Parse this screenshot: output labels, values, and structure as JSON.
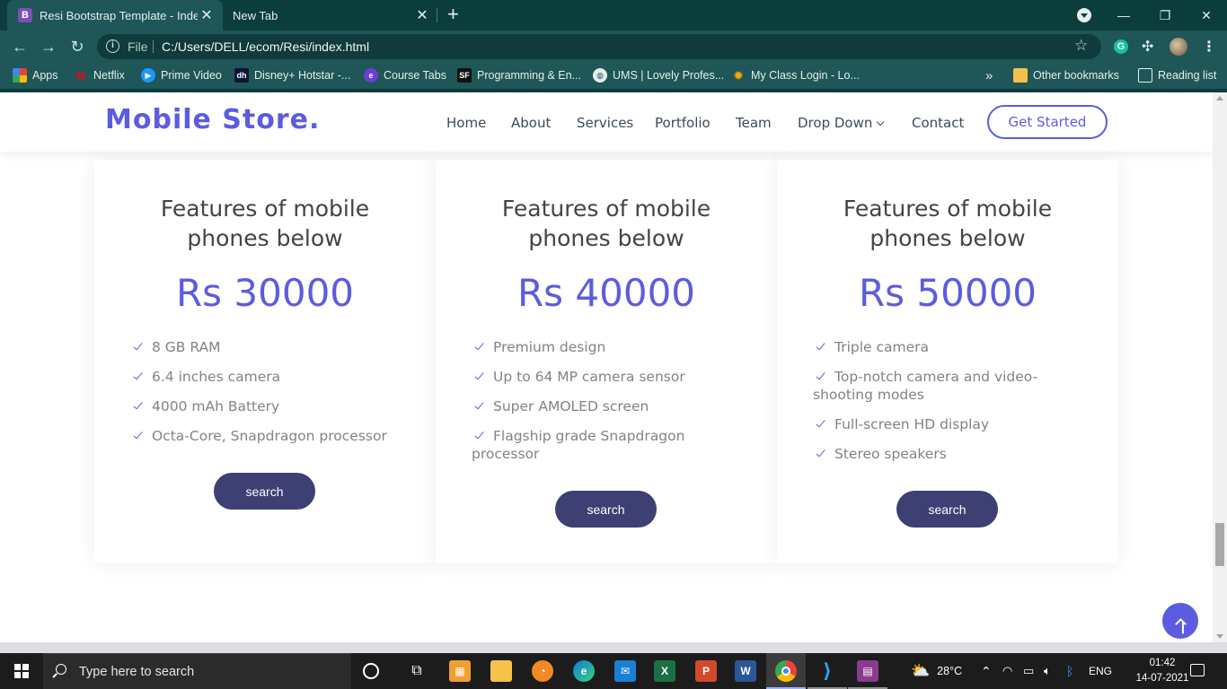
{
  "browser": {
    "tabs": [
      {
        "title": "Resi Bootstrap Template - Index",
        "favicon": "B",
        "active": true
      },
      {
        "title": "New Tab",
        "active": false
      }
    ],
    "address": {
      "scheme_label": "File",
      "url": "C:/Users/DELL/ecom/Resi/index.html"
    },
    "bookmarks": [
      {
        "label": "Apps",
        "icon": "apps-grid-icon"
      },
      {
        "label": "Netflix",
        "icon": "netflix-icon"
      },
      {
        "label": "Prime Video",
        "icon": "prime-video-icon"
      },
      {
        "label": "Disney+ Hotstar -...",
        "icon": "hotstar-icon"
      },
      {
        "label": "Course Tabs",
        "icon": "course-tabs-icon"
      },
      {
        "label": "Programming & En...",
        "icon": "programming-icon"
      },
      {
        "label": "UMS | Lovely Profes...",
        "icon": "globe-icon"
      },
      {
        "label": "My Class Login - Lo...",
        "icon": "myclass-icon"
      }
    ],
    "bookmarks_overflow": "»",
    "other_bookmarks": "Other bookmarks",
    "reading_list": "Reading list"
  },
  "site": {
    "logo": "Mobile Store.",
    "nav": [
      "Home",
      "About",
      "Services",
      "Portfolio",
      "Team",
      "Drop Down",
      "Contact"
    ],
    "cta": "Get Started"
  },
  "cards": [
    {
      "title": "Features of mobile phones below",
      "price": "Rs 30000",
      "features": [
        "8 GB RAM",
        "6.4 inches camera",
        "4000 mAh Battery",
        "Octa-Core, Snapdragon processor"
      ],
      "button": "search"
    },
    {
      "title": "Features of mobile phones below",
      "price": "Rs 40000",
      "features": [
        "Premium design",
        "Up to 64 MP camera sensor",
        "Super AMOLED screen",
        "Flagship grade Snapdragon processor"
      ],
      "button": "search"
    },
    {
      "title": "Features of mobile phones below",
      "price": "Rs 50000",
      "features": [
        "Triple camera",
        "Top-notch camera and video-shooting modes",
        "Full-screen HD display",
        "Stereo speakers"
      ],
      "button": "search"
    }
  ],
  "taskbar": {
    "search_placeholder": "Type here to search",
    "weather": "28°C",
    "language": "ENG",
    "time": "01:42",
    "date": "14-07-2021"
  },
  "colors": {
    "accent": "#5c5ce0",
    "button": "#3e3f73",
    "chrome": "#1f5657"
  }
}
